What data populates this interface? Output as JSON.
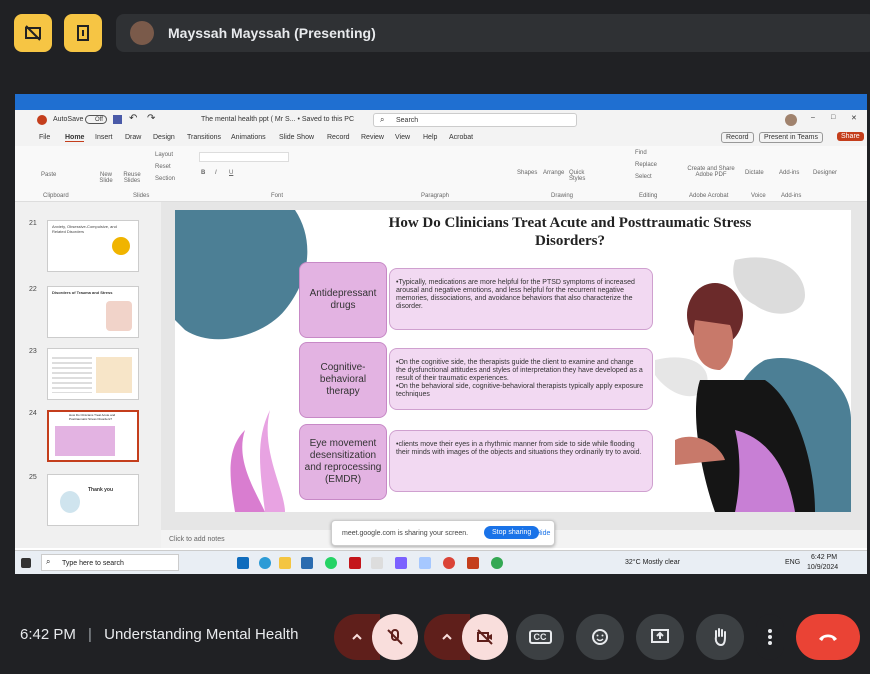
{
  "meet": {
    "presenter_name": "Mayssah Mayssah (Presenting)",
    "time": "6:42 PM",
    "divider": "|",
    "meeting_title": "Understanding Mental Health"
  },
  "ppt": {
    "autosave_label": "AutoSave",
    "autosave_state": "Off",
    "file_title": "The mental health ppt ( Mr S... • Saved to this PC",
    "search_placeholder": "Search",
    "menu": [
      "File",
      "Home",
      "Insert",
      "Draw",
      "Design",
      "Transitions",
      "Animations",
      "Slide Show",
      "Record",
      "Review",
      "View",
      "Help",
      "Acrobat"
    ],
    "record_btn": "Record",
    "present_teams_btn": "Present in Teams",
    "share_btn": "Share",
    "ribbon_groups": [
      "Clipboard",
      "Slides",
      "Font",
      "Paragraph",
      "Drawing",
      "Editing",
      "Adobe Acrobat",
      "Voice",
      "Add-ins"
    ],
    "ribbon_buttons": {
      "paste": "Paste",
      "new_slide": "New Slide",
      "reuse_slides": "Reuse Slides",
      "layout": "Layout",
      "reset": "Reset",
      "section": "Section",
      "shapes": "Shapes",
      "arrange": "Arrange",
      "quick_styles": "Quick Styles",
      "find": "Find",
      "replace": "Replace",
      "select": "Select",
      "create_share_pdf": "Create and Share Adobe PDF",
      "dictate": "Dictate",
      "add_ins": "Add-ins",
      "designer": "Designer"
    },
    "thumbnail_numbers": [
      "21",
      "22",
      "23",
      "24",
      "25"
    ],
    "thumbnail_titles": [
      "Anxiety, Obsessive-Compulsive, and Related Disorders",
      "Disorders of Trauma and Stress",
      "",
      "How Do Clinicians Treat Acute and Posttraumatic Stress Disorders?",
      "Thank you"
    ],
    "notes_placeholder": "Click to add notes"
  },
  "slide": {
    "title": "How Do Clinicians Treat Acute and Posttraumatic Stress Disorders?",
    "rows": [
      {
        "label": "Antidepressant drugs",
        "text": "•Typically, medications are more helpful for the PTSD symptoms of increased arousal and negative emotions, and less helpful for the recurrent negative memories, dissociations, and avoidance behaviors that also characterize the disorder."
      },
      {
        "label": "Cognitive-behavioral therapy",
        "text": "•On the cognitive side, the therapists guide the client to examine and change the dysfunctional attitudes and styles of interpretation they have developed as a result of their traumatic experiences.",
        "text2": "•On the behavioral side, cognitive-behavioral therapists typically apply exposure techniques"
      },
      {
        "label": "Eye movement desensitization and reprocessing (EMDR)",
        "text": "•clients move their eyes in a rhythmic manner from side to side while flooding their minds with images of the objects and situations they ordinarily try to avoid."
      }
    ]
  },
  "share_bar": {
    "message": "meet.google.com is sharing your screen.",
    "stop_btn": "Stop sharing",
    "hide_btn": "Hide"
  },
  "taskbar": {
    "search_placeholder": "Type here to search",
    "weather": "32°C Mostly clear",
    "lang": "ENG",
    "time": "6:42 PM",
    "date": "10/9/2024"
  },
  "controls": {
    "cc_label": "CC"
  },
  "colors": {
    "meet_bg": "#202124",
    "warning_yellow": "#f6c544",
    "end_call_red": "#ea4335",
    "muted_pink": "#f9dedc",
    "slide_purple": "#e3b3e2"
  }
}
